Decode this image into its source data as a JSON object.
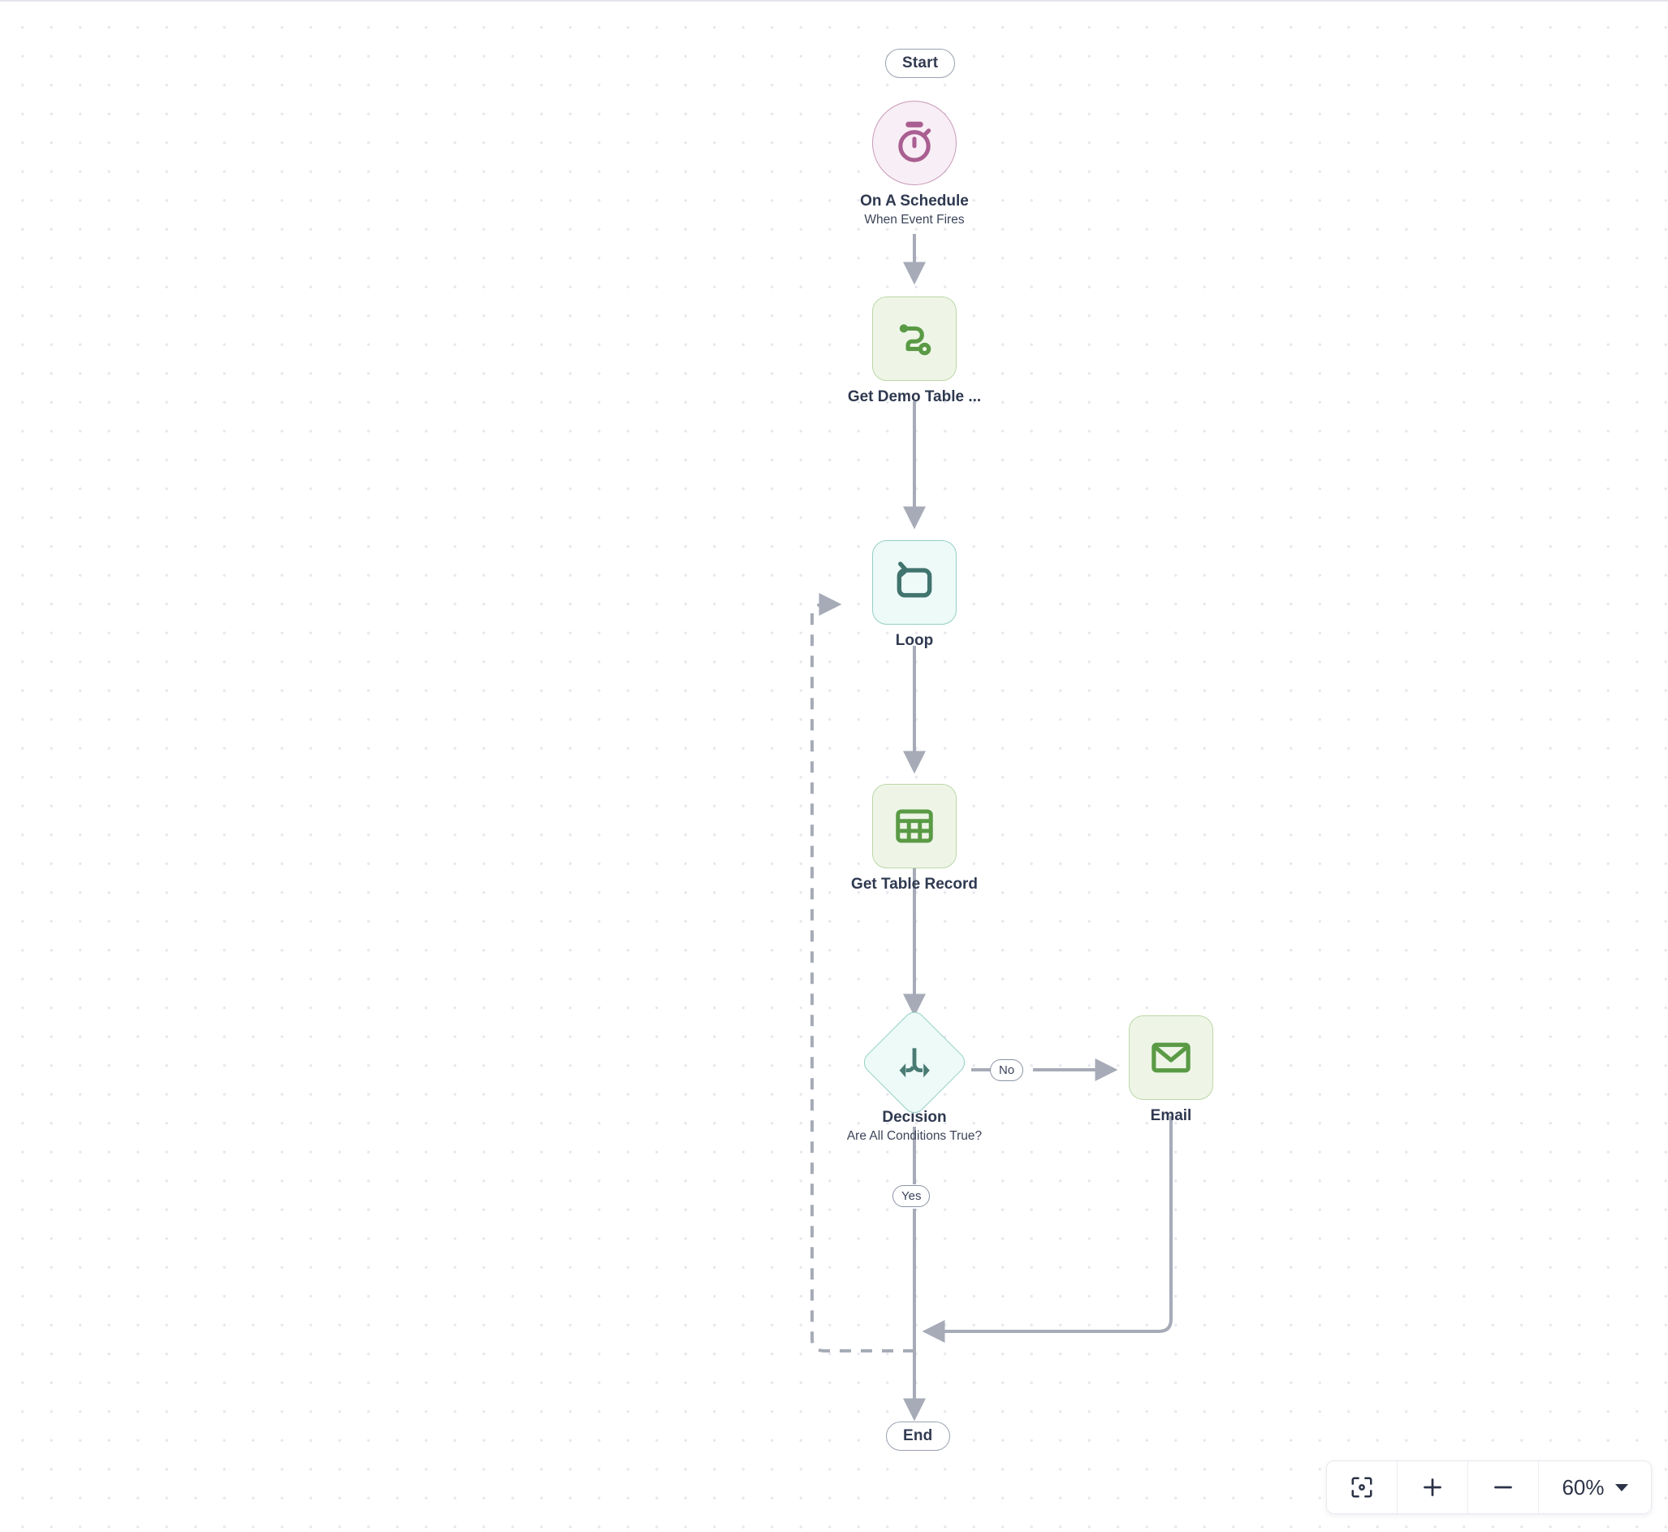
{
  "canvas": {
    "background": "dot-grid",
    "grid_color": "#e7e7ee"
  },
  "flow": {
    "start_label": "Start",
    "end_label": "End",
    "nodes": [
      {
        "id": "on-a-schedule",
        "title": "On A Schedule",
        "subtitle": "When Event Fires",
        "icon": "stopwatch-icon",
        "shape": "circle",
        "fill": "#f8eef5",
        "stroke": "#c89ab9",
        "icon_color": "#a95f91"
      },
      {
        "id": "get-demo-table",
        "title": "Get Demo Table ...",
        "subtitle": "",
        "icon": "route-icon",
        "shape": "rounded-square",
        "fill": "#eef5e7",
        "stroke": "#bcd7a6",
        "icon_color": "#5a9a45"
      },
      {
        "id": "loop",
        "title": "Loop",
        "subtitle": "",
        "icon": "repeat-icon",
        "shape": "rounded-square",
        "fill": "#edfaf7",
        "stroke": "#95cfc5",
        "icon_color": "#41746e"
      },
      {
        "id": "get-table-record",
        "title": "Get Table Record",
        "subtitle": "",
        "icon": "table-icon",
        "shape": "rounded-square",
        "fill": "#eef5e7",
        "stroke": "#bcd7a6",
        "icon_color": "#5a9a45"
      },
      {
        "id": "decision",
        "title": "Decision",
        "subtitle": "Are All Conditions True?",
        "icon": "branch-split-icon",
        "shape": "diamond",
        "fill": "#edfaf7",
        "stroke": "#95cfc5",
        "icon_color": "#4a7b75"
      },
      {
        "id": "email",
        "title": "Email",
        "subtitle": "",
        "icon": "envelope-icon",
        "shape": "rounded-square",
        "fill": "#eef5e7",
        "stroke": "#bcd7a6",
        "icon_color": "#5a9a45"
      }
    ],
    "edge_labels": {
      "no": "No",
      "yes": "Yes"
    },
    "edge_color": "#a6abb7"
  },
  "zoom_toolbar": {
    "fit_icon": "fit-to-screen-icon",
    "zoom_in_icon": "plus-icon",
    "zoom_out_icon": "minus-icon",
    "level": "60%",
    "caret_icon": "chevron-down-icon"
  }
}
